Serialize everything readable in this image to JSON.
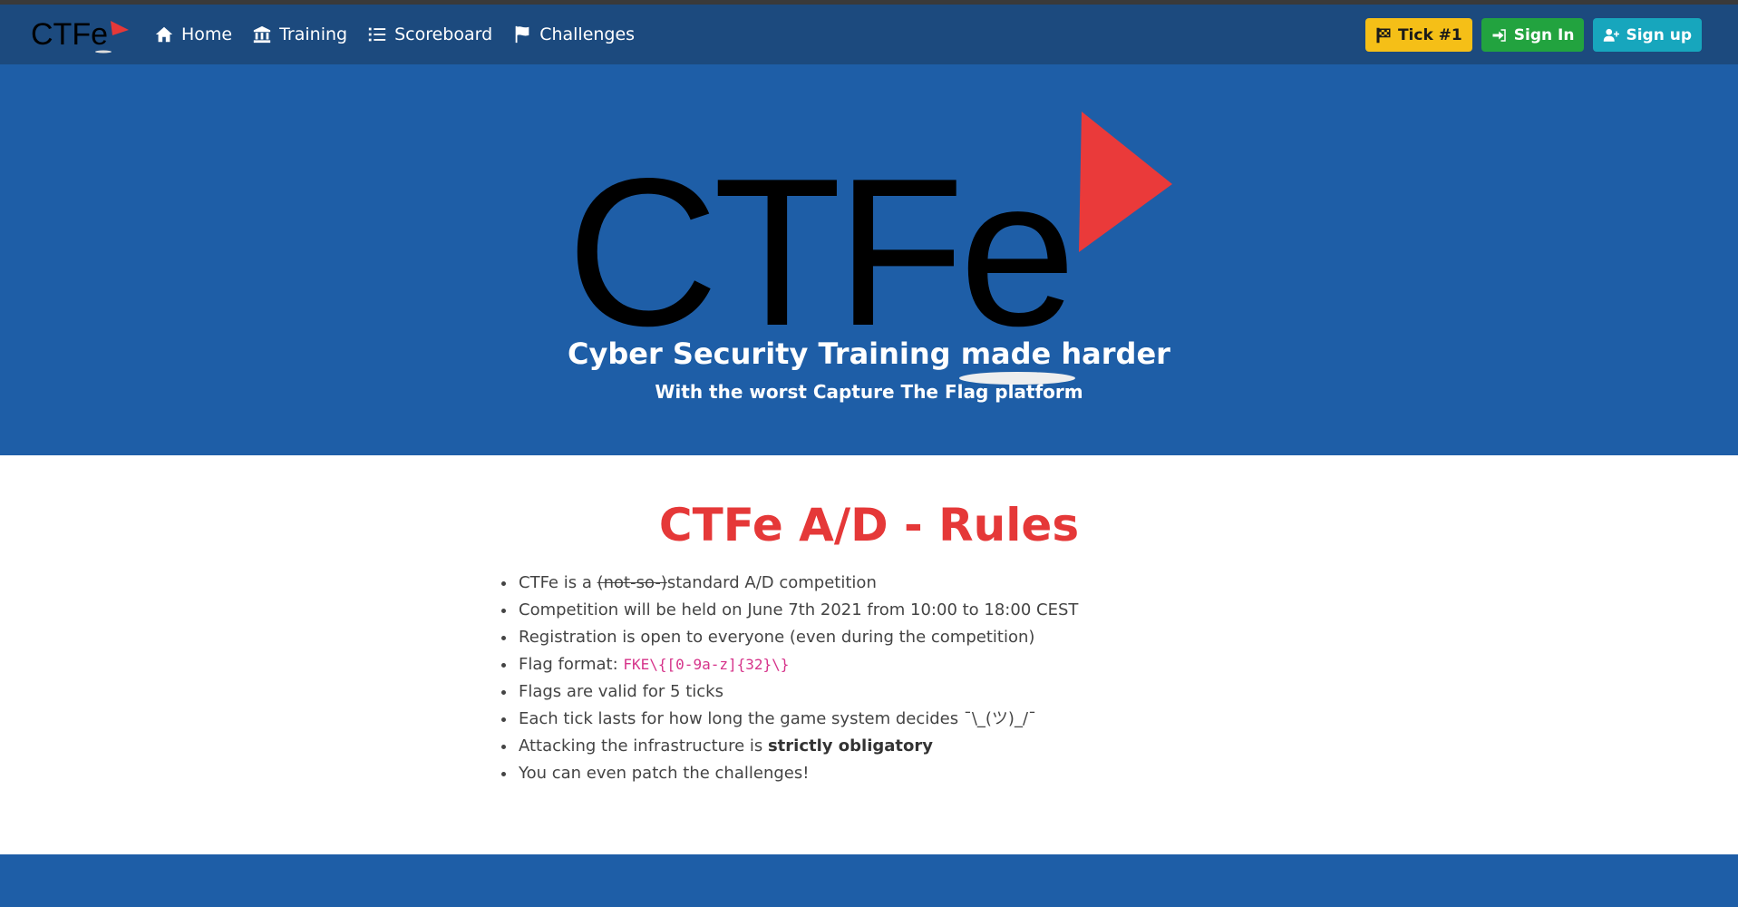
{
  "navbar": {
    "brand": "CTFe",
    "links": [
      {
        "label": "Home",
        "icon": "home-icon"
      },
      {
        "label": "Training",
        "icon": "university-icon"
      },
      {
        "label": "Scoreboard",
        "icon": "list-icon"
      },
      {
        "label": "Challenges",
        "icon": "flag-icon"
      }
    ],
    "tick_label": "Tick #1",
    "signin_label": "Sign In",
    "signup_label": "Sign up"
  },
  "hero": {
    "logo_text": "CTFe",
    "title": "Cyber Security Training made harder",
    "subtitle": "With the worst Capture The Flag platform"
  },
  "rules": {
    "title": "CTFe A/D - Rules",
    "items": [
      {
        "prefix": "CTFe is a ",
        "struck": "(not-so-)",
        "suffix": "standard A/D competition"
      },
      {
        "text": "Competition will be held on June 7th 2021 from 10:00 to 18:00 CEST"
      },
      {
        "text": "Registration is open to everyone (even during the competition)"
      },
      {
        "prefix": "Flag format: ",
        "code": "FKE\\{[0-9a-z]{32}\\}"
      },
      {
        "text": "Flags are valid for 5 ticks"
      },
      {
        "text": "Each tick lasts for how long the game system decides ¯\\_(ツ)_/¯"
      },
      {
        "prefix": "Attacking the infrastructure is ",
        "bold": "strictly obligatory"
      },
      {
        "text": "You can even patch the challenges!"
      }
    ]
  },
  "colors": {
    "navbar": "#1c4a7e",
    "hero": "#1e5ea7",
    "accent_red": "#e53838",
    "tick_button": "#f5bf17",
    "signin_button": "#22a33f",
    "signup_button": "#17a6bd"
  }
}
